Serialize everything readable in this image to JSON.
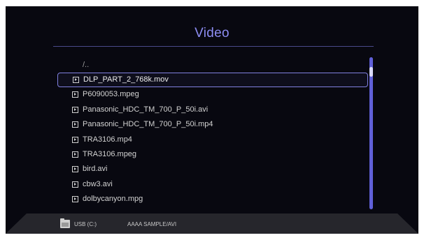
{
  "header": {
    "title": "Video"
  },
  "list": {
    "parent": "/..",
    "items": [
      "DLP_PART_2_768k.mov",
      "P6090053.mpeg",
      "Panasonic_HDC_TM_700_P_50i.avi",
      "Panasonic_HDC_TM_700_P_50i.mp4",
      "TRA3106.mp4",
      "TRA3106.mpeg",
      "bird.avi",
      "cbw3.avi",
      "dolbycanyon.mpg"
    ],
    "selected_index": 0
  },
  "status": {
    "drive": "USB (C:)",
    "path": "AAAA SAMPLE/AVI"
  },
  "colors": {
    "accent": "#8080e0",
    "background": "#080810"
  },
  "icons": {
    "file": "play-file-icon",
    "folder": "folder-icon"
  }
}
